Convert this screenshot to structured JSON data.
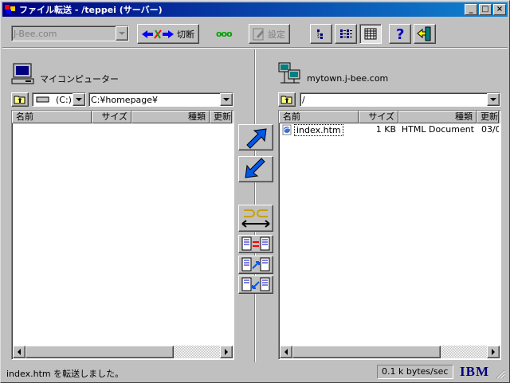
{
  "window": {
    "title": "ファイル転送 - /teppei (サーバー)",
    "minimize": "_",
    "maximize": "□",
    "close": "×"
  },
  "toolbar": {
    "site_combo": "J-Bee.com",
    "disconnect_label": "切断",
    "settings_label": "設定",
    "status_dots": "ooo"
  },
  "local": {
    "title": "マイコンピューター",
    "drive": "(C:)",
    "path": "C:¥homepage¥",
    "columns": [
      "名前",
      "サイズ",
      "種類",
      "更新"
    ],
    "files": []
  },
  "remote": {
    "title": "mytown.j-bee.com",
    "path": "/",
    "columns": [
      "名前",
      "サイズ",
      "種類",
      "更新"
    ],
    "files": [
      {
        "name": "index.htm",
        "size": "1 KB",
        "type": "HTML Document",
        "date": "03/0"
      }
    ]
  },
  "statusbar": {
    "message": "index.htm を転送しました。",
    "speed": "0.1 k bytes/sec",
    "logo": "IBM"
  },
  "colors": {
    "title_start": "#000080",
    "title_end": "#1084d0",
    "arrow_blue": "#0058e8"
  }
}
